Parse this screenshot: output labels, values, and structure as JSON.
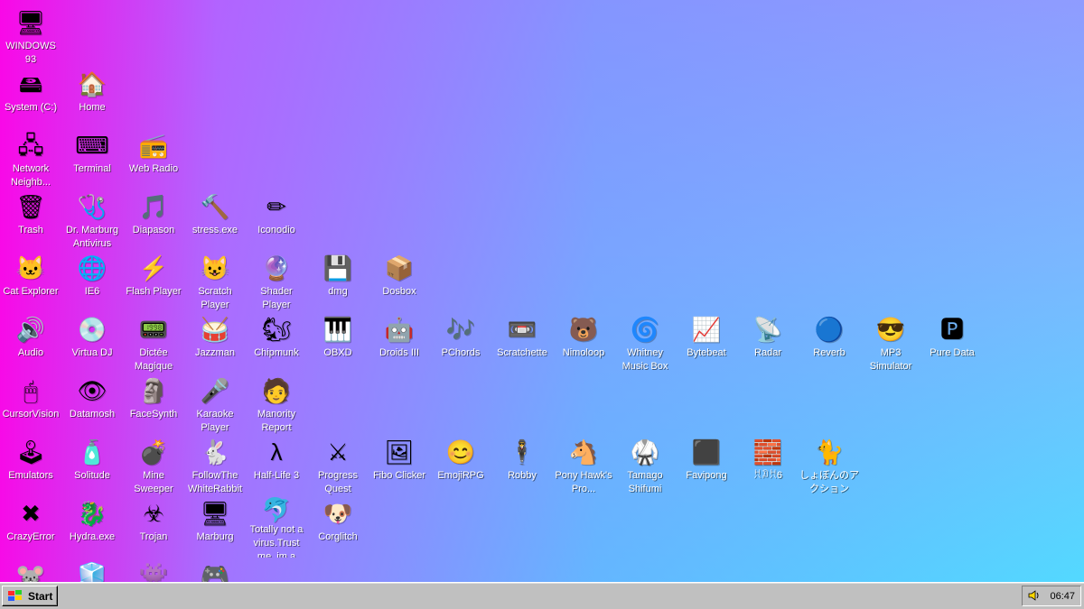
{
  "desktop": {
    "icons": [
      {
        "label": "WINDOWS 93",
        "glyph": "🖥"
      },
      {
        "label": "",
        "glyph": ""
      },
      {
        "label": "",
        "glyph": ""
      },
      {
        "label": "",
        "glyph": ""
      },
      {
        "label": "",
        "glyph": ""
      },
      {
        "label": "",
        "glyph": ""
      },
      {
        "label": "",
        "glyph": ""
      },
      {
        "label": "",
        "glyph": ""
      },
      {
        "label": "",
        "glyph": ""
      },
      {
        "label": "",
        "glyph": ""
      },
      {
        "label": "",
        "glyph": ""
      },
      {
        "label": "",
        "glyph": ""
      },
      {
        "label": "",
        "glyph": ""
      },
      {
        "label": "",
        "glyph": ""
      },
      {
        "label": "",
        "glyph": ""
      },
      {
        "label": "",
        "glyph": ""
      },
      {
        "label": "",
        "glyph": ""
      },
      {
        "label": "System (C:)",
        "glyph": "🖴"
      },
      {
        "label": "Home",
        "glyph": "🏠"
      },
      {
        "label": "",
        "glyph": ""
      },
      {
        "label": "",
        "glyph": ""
      },
      {
        "label": "",
        "glyph": ""
      },
      {
        "label": "",
        "glyph": ""
      },
      {
        "label": "",
        "glyph": ""
      },
      {
        "label": "",
        "glyph": ""
      },
      {
        "label": "",
        "glyph": ""
      },
      {
        "label": "",
        "glyph": ""
      },
      {
        "label": "",
        "glyph": ""
      },
      {
        "label": "",
        "glyph": ""
      },
      {
        "label": "",
        "glyph": ""
      },
      {
        "label": "",
        "glyph": ""
      },
      {
        "label": "",
        "glyph": ""
      },
      {
        "label": "",
        "glyph": ""
      },
      {
        "label": "",
        "glyph": ""
      },
      {
        "label": "Network Neighb...",
        "glyph": "🖧"
      },
      {
        "label": "Terminal",
        "glyph": "⌨"
      },
      {
        "label": "Web Radio",
        "glyph": "📻"
      },
      {
        "label": "",
        "glyph": ""
      },
      {
        "label": "",
        "glyph": ""
      },
      {
        "label": "",
        "glyph": ""
      },
      {
        "label": "",
        "glyph": ""
      },
      {
        "label": "",
        "glyph": ""
      },
      {
        "label": "",
        "glyph": ""
      },
      {
        "label": "",
        "glyph": ""
      },
      {
        "label": "",
        "glyph": ""
      },
      {
        "label": "",
        "glyph": ""
      },
      {
        "label": "",
        "glyph": ""
      },
      {
        "label": "",
        "glyph": ""
      },
      {
        "label": "",
        "glyph": ""
      },
      {
        "label": "",
        "glyph": ""
      },
      {
        "label": "",
        "glyph": ""
      },
      {
        "label": "Trash",
        "glyph": "🗑"
      },
      {
        "label": "Dr. Marburg Antivirus",
        "glyph": "🩺"
      },
      {
        "label": "Diapason",
        "glyph": "🎵"
      },
      {
        "label": "stress.exe",
        "glyph": "🔨"
      },
      {
        "label": "Iconodio",
        "glyph": "✏"
      },
      {
        "label": "",
        "glyph": ""
      },
      {
        "label": "",
        "glyph": ""
      },
      {
        "label": "",
        "glyph": ""
      },
      {
        "label": "",
        "glyph": ""
      },
      {
        "label": "",
        "glyph": ""
      },
      {
        "label": "",
        "glyph": ""
      },
      {
        "label": "",
        "glyph": ""
      },
      {
        "label": "",
        "glyph": ""
      },
      {
        "label": "",
        "glyph": ""
      },
      {
        "label": "",
        "glyph": ""
      },
      {
        "label": "",
        "glyph": ""
      },
      {
        "label": "",
        "glyph": ""
      },
      {
        "label": "Cat Explorer",
        "glyph": "🐱"
      },
      {
        "label": "IE6",
        "glyph": "🌐"
      },
      {
        "label": "Flash Player",
        "glyph": "⚡"
      },
      {
        "label": "Scratch Player",
        "glyph": "😺"
      },
      {
        "label": "Shader Player",
        "glyph": "🔮"
      },
      {
        "label": "dmg",
        "glyph": "💾"
      },
      {
        "label": "Dosbox",
        "glyph": "📦"
      },
      {
        "label": "",
        "glyph": ""
      },
      {
        "label": "",
        "glyph": ""
      },
      {
        "label": "",
        "glyph": ""
      },
      {
        "label": "",
        "glyph": ""
      },
      {
        "label": "",
        "glyph": ""
      },
      {
        "label": "",
        "glyph": ""
      },
      {
        "label": "",
        "glyph": ""
      },
      {
        "label": "",
        "glyph": ""
      },
      {
        "label": "",
        "glyph": ""
      },
      {
        "label": "",
        "glyph": ""
      },
      {
        "label": "Audio",
        "glyph": "🔊"
      },
      {
        "label": "Virtua DJ",
        "glyph": "💿"
      },
      {
        "label": "Dictée Magique",
        "glyph": "📟"
      },
      {
        "label": "Jazzman",
        "glyph": "🥁"
      },
      {
        "label": "Chipmunk",
        "glyph": "🐿"
      },
      {
        "label": "OBXD",
        "glyph": "🎹"
      },
      {
        "label": "Droids III",
        "glyph": "🤖"
      },
      {
        "label": "PChords",
        "glyph": "🎶"
      },
      {
        "label": "Scratchette",
        "glyph": "📼"
      },
      {
        "label": "Nimoloop",
        "glyph": "🐻"
      },
      {
        "label": "Whitney Music Box",
        "glyph": "🌀"
      },
      {
        "label": "Bytebeat",
        "glyph": "📈"
      },
      {
        "label": "Radar",
        "glyph": "📡"
      },
      {
        "label": "Reverb",
        "glyph": "🔵"
      },
      {
        "label": "MP3 Simulator",
        "glyph": "😎"
      },
      {
        "label": "Pure Data",
        "glyph": "🅿"
      },
      {
        "label": "",
        "glyph": ""
      },
      {
        "label": "CursorVision",
        "glyph": "🖱"
      },
      {
        "label": "Datamosh",
        "glyph": "👁"
      },
      {
        "label": "FaceSynth",
        "glyph": "🗿"
      },
      {
        "label": "Karaoke Player",
        "glyph": "🎤"
      },
      {
        "label": "Manority Report",
        "glyph": "🧑"
      },
      {
        "label": "",
        "glyph": ""
      },
      {
        "label": "",
        "glyph": ""
      },
      {
        "label": "",
        "glyph": ""
      },
      {
        "label": "",
        "glyph": ""
      },
      {
        "label": "",
        "glyph": ""
      },
      {
        "label": "",
        "glyph": ""
      },
      {
        "label": "",
        "glyph": ""
      },
      {
        "label": "",
        "glyph": ""
      },
      {
        "label": "",
        "glyph": ""
      },
      {
        "label": "",
        "glyph": ""
      },
      {
        "label": "",
        "glyph": ""
      },
      {
        "label": "",
        "glyph": ""
      },
      {
        "label": "Emulators",
        "glyph": "🕹"
      },
      {
        "label": "Solitude",
        "glyph": "🧴"
      },
      {
        "label": "Mine Sweeper",
        "glyph": "💣"
      },
      {
        "label": "FollowThe WhiteRabbit",
        "glyph": "🐇"
      },
      {
        "label": "Half-Life 3",
        "glyph": "λ"
      },
      {
        "label": "Progress Quest",
        "glyph": "⚔"
      },
      {
        "label": "Fibo Clicker",
        "glyph": "🖼"
      },
      {
        "label": "EmojiRPG",
        "glyph": "😊"
      },
      {
        "label": "Robby",
        "glyph": "🕴"
      },
      {
        "label": "Pony Hawk's Pro...",
        "glyph": "🐴"
      },
      {
        "label": "Tamago Shifumi",
        "glyph": "🥋"
      },
      {
        "label": "Favipong",
        "glyph": "⬛"
      },
      {
        "label": "ꀡꀣꀡ6",
        "glyph": "🧱"
      },
      {
        "label": "しょぼんのアクション",
        "glyph": "🐈"
      },
      {
        "label": "",
        "glyph": ""
      },
      {
        "label": "",
        "glyph": ""
      },
      {
        "label": "",
        "glyph": ""
      },
      {
        "label": "CrazyError",
        "glyph": "✖"
      },
      {
        "label": "Hydra.exe",
        "glyph": "🐉"
      },
      {
        "label": "Trojan",
        "glyph": "☣"
      },
      {
        "label": "Marburg",
        "glyph": "🖥"
      },
      {
        "label": "Totally not a virus.Trust me..im a dolphin",
        "glyph": "🐬"
      },
      {
        "label": "Corglitch",
        "glyph": "🐶"
      },
      {
        "label": "",
        "glyph": ""
      },
      {
        "label": "",
        "glyph": ""
      },
      {
        "label": "",
        "glyph": ""
      },
      {
        "label": "",
        "glyph": ""
      },
      {
        "label": "",
        "glyph": ""
      },
      {
        "label": "",
        "glyph": ""
      },
      {
        "label": "",
        "glyph": ""
      },
      {
        "label": "",
        "glyph": ""
      },
      {
        "label": "",
        "glyph": ""
      },
      {
        "label": "",
        "glyph": ""
      },
      {
        "label": "",
        "glyph": ""
      },
      {
        "label": "",
        "glyph": "🐭"
      },
      {
        "label": "",
        "glyph": "🧊"
      },
      {
        "label": "",
        "glyph": "👾"
      },
      {
        "label": "",
        "glyph": "🎮"
      }
    ]
  },
  "taskbar": {
    "start_label": "Start",
    "clock": "06:47",
    "speaker_icon": "speaker-icon"
  }
}
